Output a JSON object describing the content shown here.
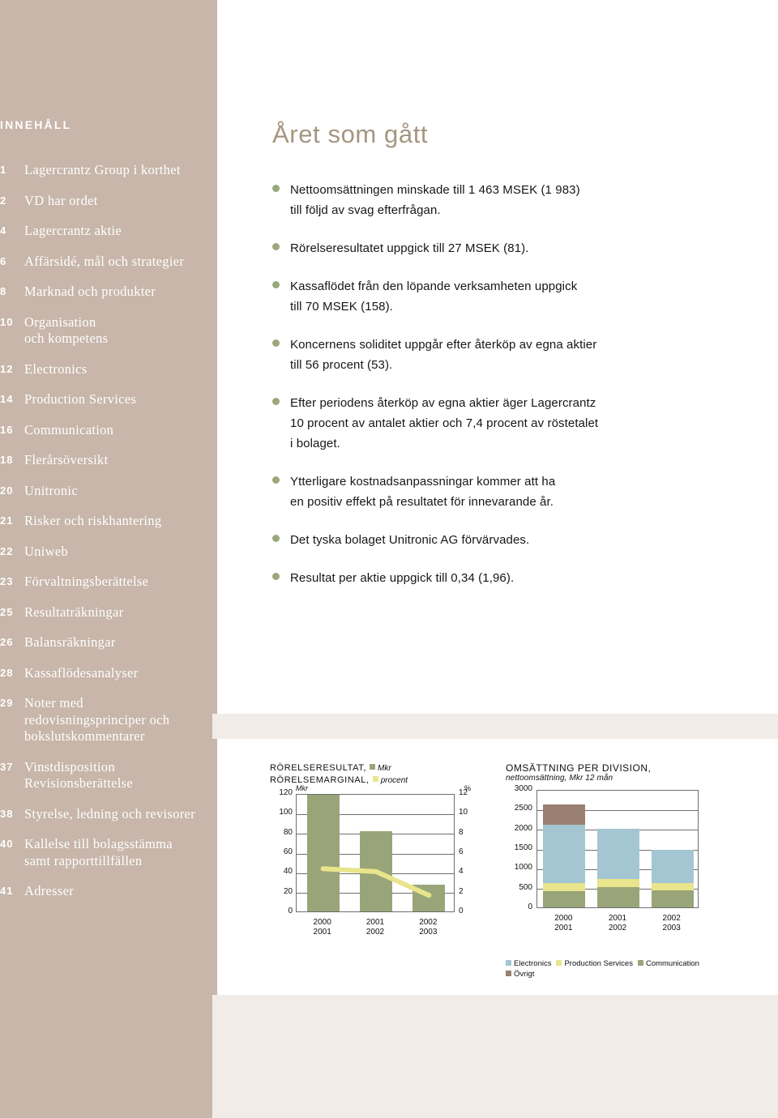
{
  "sidebar": {
    "title": "INNEHÅLL",
    "bg_color": "#c7b6a9",
    "items": [
      {
        "num": "1",
        "label": "Lagercrantz Group i korthet"
      },
      {
        "num": "2",
        "label": "VD har ordet"
      },
      {
        "num": "4",
        "label": "Lagercrantz aktie"
      },
      {
        "num": "6",
        "label": "Affärsidé, mål och strategier"
      },
      {
        "num": "8",
        "label": "Marknad och produkter"
      },
      {
        "num": "10",
        "label": "Organisation\noch kompetens"
      },
      {
        "num": "12",
        "label": "Electronics"
      },
      {
        "num": "14",
        "label": "Production Services"
      },
      {
        "num": "16",
        "label": "Communication"
      },
      {
        "num": "18",
        "label": "Flerårsöversikt"
      },
      {
        "num": "20",
        "label": "Unitronic"
      },
      {
        "num": "21",
        "label": "Risker och riskhantering"
      },
      {
        "num": "22",
        "label": "Uniweb"
      },
      {
        "num": "23",
        "label": "Förvaltningsberättelse"
      },
      {
        "num": "25",
        "label": "Resultaträkningar"
      },
      {
        "num": "26",
        "label": "Balansräkningar"
      },
      {
        "num": "28",
        "label": "Kassaflödesanalyser"
      },
      {
        "num": "29",
        "label": "Noter med\nredovisningsprinciper och\nbokslutskommentarer"
      },
      {
        "num": "37",
        "label": "Vinstdisposition\nRevisionsberättelse"
      },
      {
        "num": "38",
        "label": "Styrelse, ledning och revisorer"
      },
      {
        "num": "40",
        "label": "Kallelse till bolagsstämma\nsamt rapporttillfällen"
      },
      {
        "num": "41",
        "label": "Adresser"
      }
    ]
  },
  "main": {
    "title": "Året som gått",
    "title_color": "#a6957f",
    "bullet_color": "#9aa87c",
    "bullets": [
      "Nettoomsättningen minskade  till 1 463 MSEK (1 983)\ntill följd av svag efterfrågan.",
      "Rörelseresultatet uppgick till 27 MSEK (81).",
      "Kassaflödet från den löpande verksamheten uppgick\ntill 70 MSEK (158).",
      "Koncernens soliditet uppgår efter återköp av egna aktier\ntill 56 procent (53).",
      "Efter periodens återköp av egna aktier äger Lagercrantz\n10 procent av antalet aktier och 7,4 procent av röstetalet\ni bolaget.",
      "Ytterligare kostnadsanpassningar kommer att ha\nen positiv effekt på resultatet för innevarande år.",
      "Det tyska bolaget Unitronic AG förvärvades.",
      "Resultat per aktie uppgick till  0,34 (1,96)."
    ]
  },
  "chart_data": [
    {
      "id": "chart1",
      "type": "bar",
      "title_line1": "RÖRELSERESULTAT,",
      "title_line1_legend": "Mkr",
      "title_line2": "RÖRELSEMARGINAL,",
      "title_line2_legend": "procent",
      "ylabel": "Mkr",
      "ylabel_right": "%",
      "categories": [
        "2000\n2001",
        "2001\n2002",
        "2002\n2003"
      ],
      "ylim": [
        0,
        120
      ],
      "yticks": [
        "0",
        "20",
        "40",
        "60",
        "80",
        "100",
        "120"
      ],
      "ylim_right": [
        0,
        12
      ],
      "yticks_right": [
        "0",
        "2",
        "4",
        "6",
        "8",
        "10",
        "12"
      ],
      "grid": true,
      "series": [
        {
          "name": "Mkr",
          "kind": "bar",
          "color": "#99a578",
          "values": [
            118,
            81,
            27
          ]
        },
        {
          "name": "procent",
          "kind": "line",
          "color": "#e8e58c",
          "values": [
            4.5,
            4.2,
            1.8
          ]
        }
      ]
    },
    {
      "id": "chart2",
      "type": "bar",
      "title": "OMSÄTTNING PER DIVISION,",
      "subtitle": "nettoomsättning, Mkr 12 mån",
      "categories": [
        "2000\n2001",
        "2001\n2002",
        "2002\n2003"
      ],
      "ylim": [
        0,
        3000
      ],
      "yticks": [
        "0",
        "500",
        "1000",
        "1500",
        "2000",
        "2500",
        "3000"
      ],
      "grid": true,
      "stacked": true,
      "series": [
        {
          "name": "Communication",
          "color": "#99a578",
          "values": [
            410,
            510,
            435
          ]
        },
        {
          "name": "Production Services",
          "color": "#e8e58c",
          "values": [
            210,
            215,
            190
          ]
        },
        {
          "name": "Electronics",
          "color": "#a3c6d2",
          "values": [
            1480,
            1275,
            830
          ]
        },
        {
          "name": "Övrigt",
          "color": "#9a8070",
          "values": [
            510,
            0,
            0
          ]
        }
      ],
      "legend_order": [
        "Electronics",
        "Production Services",
        "Communication",
        "Övrigt"
      ],
      "legend_position": "bottom"
    }
  ]
}
